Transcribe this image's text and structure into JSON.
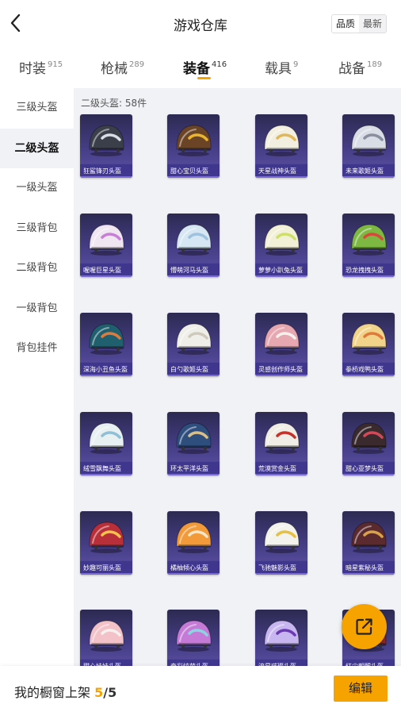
{
  "header": {
    "title": "游戏仓库",
    "sort_options": [
      "品质",
      "最新"
    ]
  },
  "tabs": [
    {
      "label": "时装",
      "count": "915"
    },
    {
      "label": "枪械",
      "count": "289"
    },
    {
      "label": "装备",
      "count": "416"
    },
    {
      "label": "载具",
      "count": "9"
    },
    {
      "label": "战备",
      "count": "189"
    }
  ],
  "active_tab": "装备",
  "sidebar": {
    "items": [
      "三级头盔",
      "二级头盔",
      "一级头盔",
      "三级背包",
      "二级背包",
      "一级背包",
      "背包挂件"
    ],
    "active": "二级头盔"
  },
  "content": {
    "count_label": "二级头盔: 58件",
    "items": [
      {
        "name": "狂鲨锋刃头盔",
        "color": "#3b3f4a",
        "accent": "#d8dce4"
      },
      {
        "name": "甜心宝贝头盔",
        "color": "#6b4426",
        "accent": "#e9b52f"
      },
      {
        "name": "天星战神头盔",
        "color": "#f2eee0",
        "accent": "#e0b85a"
      },
      {
        "name": "未来歌姬头盔",
        "color": "#d9dde6",
        "accent": "#8a8fa0"
      },
      {
        "name": "喔喔巨星头盔",
        "color": "#f0e6f2",
        "accent": "#c77fd6"
      },
      {
        "name": "懵萌河马头盔",
        "color": "#d6e6f2",
        "accent": "#9fc2dd"
      },
      {
        "name": "萝萝小趴兔头盔",
        "color": "#f3f0d8",
        "accent": "#cfe06a"
      },
      {
        "name": "恐龙拽拽头盔",
        "color": "#7cb842",
        "accent": "#d64a3a"
      },
      {
        "name": "深海小丑鱼头盔",
        "color": "#1f5f6e",
        "accent": "#e07a3a"
      },
      {
        "name": "白勺歌姬头盔",
        "color": "#efeee8",
        "accent": "#cfcabd"
      },
      {
        "name": "灵感创作师头盔",
        "color": "#e6a7b0",
        "accent": "#f3f0ee"
      },
      {
        "name": "拳桥戏鸭头盔",
        "color": "#f2d38a",
        "accent": "#e07a3a"
      },
      {
        "name": "绒雪飘舞头盔",
        "color": "#e8f0f2",
        "accent": "#8fc0d6"
      },
      {
        "name": "环太平洋头盔",
        "color": "#2e4e7e",
        "accent": "#d9c08a"
      },
      {
        "name": "荒漠赏金头盔",
        "color": "#f0ece6",
        "accent": "#c4322a"
      },
      {
        "name": "甜心亚梦头盔",
        "color": "#3a2a2e",
        "accent": "#d14a5a"
      },
      {
        "name": "妙趣可丽头盔",
        "color": "#b82f3a",
        "accent": "#f2c24a"
      },
      {
        "name": "橘柚倾心头盔",
        "color": "#f29a3a",
        "accent": "#f2e6c8"
      },
      {
        "name": "飞驰魅影头盔",
        "color": "#f4f2ec",
        "accent": "#e6c040"
      },
      {
        "name": "暗星紫秘头盔",
        "color": "#5a2a2e",
        "accent": "#d9a24a"
      },
      {
        "name": "甜心娃娃头盔",
        "color": "#f2c2c8",
        "accent": "#f4f0ee"
      },
      {
        "name": "奇彩炫萌头盔",
        "color": "#c47ad6",
        "accent": "#8ad6e0"
      },
      {
        "name": "流星璀璨头盔",
        "color": "#c8b6f0",
        "accent": "#6b3ab2"
      },
      {
        "name": "红尘朝醒头盔",
        "color": "#8a2a2e",
        "accent": "#e6c040"
      }
    ]
  },
  "bottom_bar": {
    "shelf_label": "我的橱窗上架",
    "shelf_current": "5",
    "shelf_separator": "/",
    "shelf_total": "5",
    "edit_label": "编辑"
  },
  "colors": {
    "accent": "#f6a300",
    "content_bg": "#f1f2f6",
    "card_top": "#2c2a52",
    "card_bottom": "#5d52a8"
  },
  "icons": {
    "back": "chevron-left-icon",
    "fab": "share-external-icon"
  }
}
